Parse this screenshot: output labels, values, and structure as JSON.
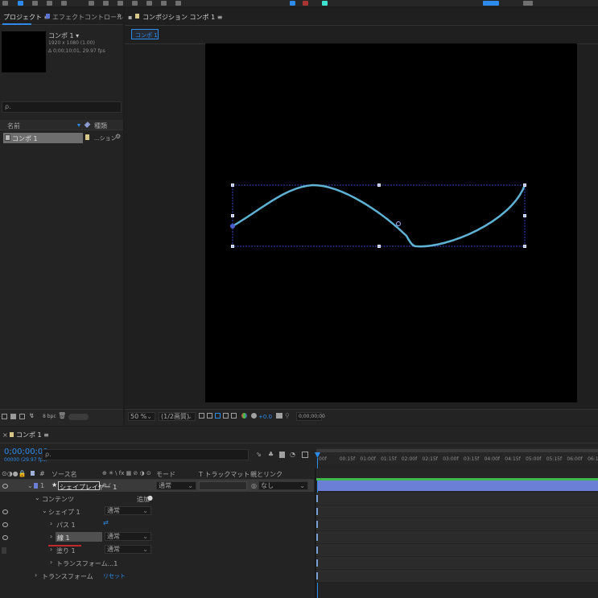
{
  "project_panel": {
    "tab_project": "プロジェクト ≡",
    "tab_effects": "エフェクトコントロール シェイプ",
    "more": "»",
    "comp_name": "コンポ 1 ▾",
    "comp_res": "1920 x 1080 (1.00)",
    "comp_dur": "Δ 0;00;10;01, 29.97 fps",
    "search_placeholder": "ρ.",
    "col_name": "名前",
    "col_type": "種類",
    "item_name": "コンポ 1",
    "item_type": "...ション",
    "bpc": "8 bpc"
  },
  "comp_viewer": {
    "tab_label": "コンポジション コンポ 1 ≡",
    "crumb": "コンポ 1",
    "zoom": "50 %",
    "resolution": "(1/2画質)",
    "exposure": "+0.0",
    "timecode": "0;00;00;00",
    "stroke_color": "#5fb2d4"
  },
  "timeline": {
    "tab_label": "コンポ 1 ≡",
    "timecode": "0;00;00;00",
    "fps": "00000 (29.97 fps)",
    "search_placeholder": "ρ.",
    "headers": {
      "layer_num": "#",
      "source": "ソース名",
      "switches": "⊕ ✳ \\ fx ▦ ⊘ ◑ ⊙",
      "mode": "モード",
      "trkmat": "T トラックマット",
      "parent": "親とリンク"
    },
    "ruler": [
      "00f",
      "00:15f",
      "01:00f",
      "01:15f",
      "02:00f",
      "02:15f",
      "03:00f",
      "03:15f",
      "04:00f",
      "04:15f",
      "05:00f",
      "05:15f",
      "06:00f",
      "06:15"
    ],
    "layer": {
      "num": "1",
      "name": "シェイプレイヤー 1",
      "mode": "通常",
      "parent": "なし"
    },
    "contents": "コンテンツ",
    "add": "追加",
    "shape_group": "シェイプ 1",
    "shape_mode": "通常",
    "path": "パス 1",
    "stroke": "線 1",
    "stroke_mode": "通常",
    "fill": "塗り 1",
    "fill_mode": "通常",
    "transform_shape": "トランスフォーム...1",
    "transform": "トランスフォーム",
    "reset": "リセット",
    "layer_bar_color": "#6b7fd6"
  }
}
